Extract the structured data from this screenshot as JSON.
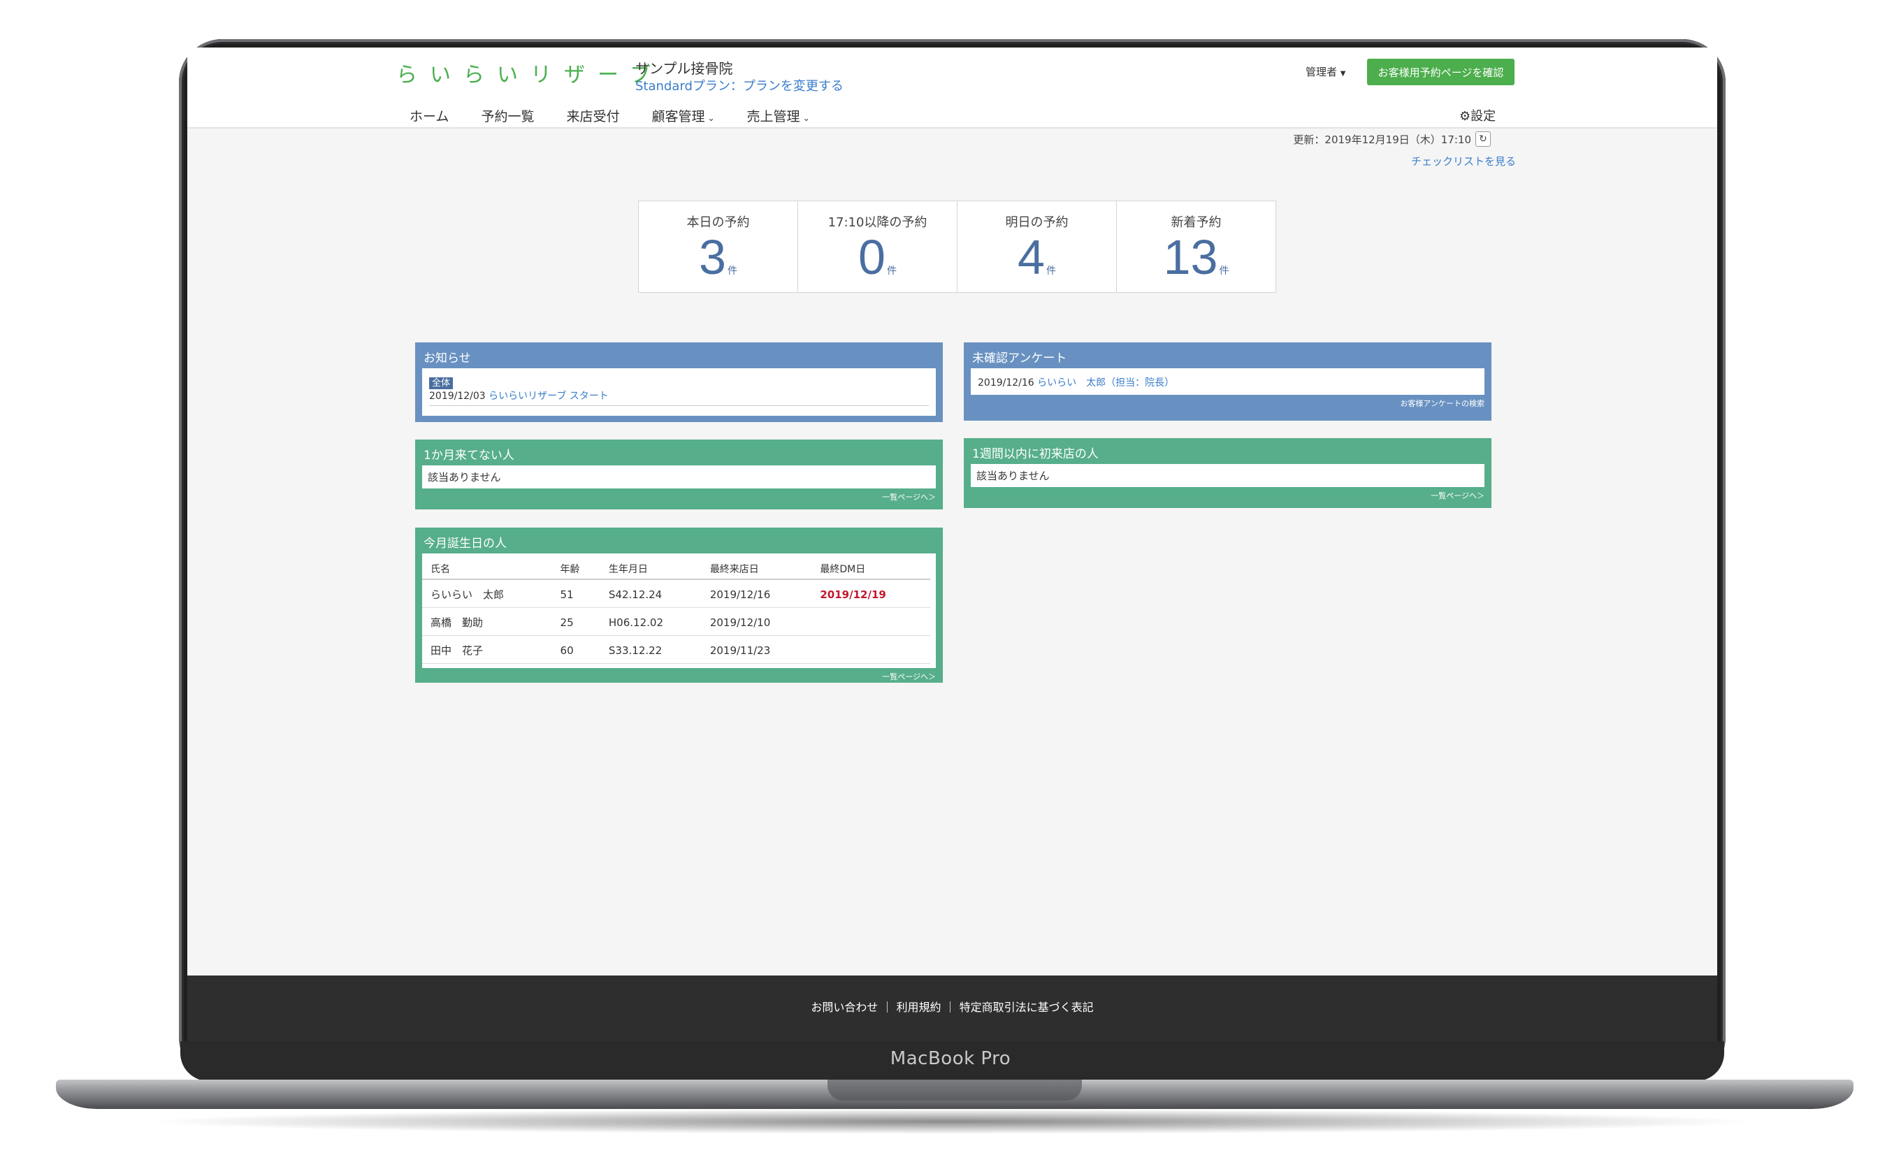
{
  "device": {
    "brand": "MacBook Pro"
  },
  "header": {
    "logo": "らいらいリザーブ",
    "clinic_name": "サンプル接骨院",
    "plan_text": "Standardプラン：プランを変更する",
    "admin": "管理者",
    "preview_button": "お客様用予約ページを確認"
  },
  "nav": {
    "items": [
      "ホーム",
      "予約一覧",
      "来店受付",
      "顧客管理",
      "売上管理"
    ],
    "settings": "設定"
  },
  "status": {
    "updated": "更新：2019年12月19日（木）17:10",
    "checklist": "チェックリストを見る"
  },
  "stats": [
    {
      "label": "本日の予約",
      "value": "3",
      "unit": "件"
    },
    {
      "label": "17:10以降の予約",
      "value": "0",
      "unit": "件"
    },
    {
      "label": "明日の予約",
      "value": "4",
      "unit": "件"
    },
    {
      "label": "新着予約",
      "value": "13",
      "unit": "件"
    }
  ],
  "notice": {
    "title": "お知らせ",
    "tag": "全体",
    "date": "2019/12/03",
    "link": "らいらいリザーブ スタート"
  },
  "survey": {
    "title": "未確認アンケート",
    "date": "2019/12/16",
    "link": "らいらい　太郎（担当：院長）",
    "footer": "お客様アンケートの検索"
  },
  "inactive": {
    "title": "1か月来てない人",
    "body": "該当ありません",
    "footer": "一覧ページへ＞"
  },
  "firstvisit": {
    "title": "1週間以内に初来店の人",
    "body": "該当ありません",
    "footer": "一覧ページへ＞"
  },
  "birthday": {
    "title": "今月誕生日の人",
    "columns": [
      "氏名",
      "年齢",
      "生年月日",
      "最終来店日",
      "最終DM日"
    ],
    "rows": [
      {
        "name": "らいらい　太郎",
        "age": "51",
        "birth": "S42.12.24",
        "last_visit": "2019/12/16",
        "last_dm": "2019/12/19"
      },
      {
        "name": "高橋　勤助",
        "age": "25",
        "birth": "H06.12.02",
        "last_visit": "2019/12/10",
        "last_dm": ""
      },
      {
        "name": "田中　花子",
        "age": "60",
        "birth": "S33.12.22",
        "last_visit": "2019/11/23",
        "last_dm": ""
      }
    ],
    "footer": "一覧ページへ＞"
  },
  "footer": {
    "text": "お問い合わせ ｜ 利用規約 ｜ 特定商取引法に基づく表記"
  },
  "colors": {
    "panel_blue": "#6891c1",
    "panel_green": "#56ae8a",
    "accent_button": "#4cae4c",
    "stat_number": "#4a6ea0",
    "alert_red": "#c0182f"
  }
}
